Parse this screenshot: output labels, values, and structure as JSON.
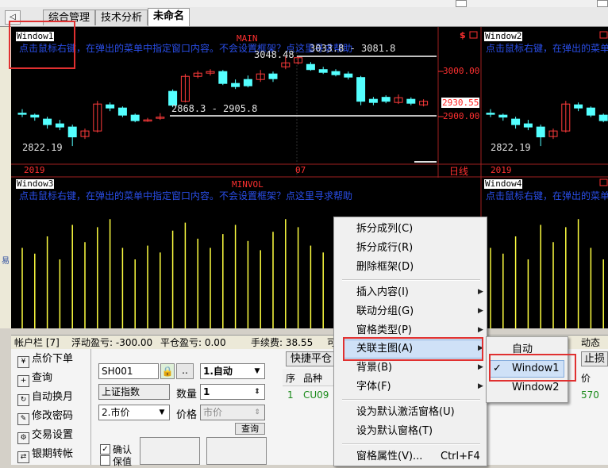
{
  "tabs": {
    "nav_glyph": "◁",
    "items": [
      {
        "label": "综合管理"
      },
      {
        "label": "技术分析"
      },
      {
        "label": "未命名"
      }
    ]
  },
  "gutter_text": "易",
  "chart": {
    "window1_label": "Window1",
    "window2_label": "Window2",
    "window3_label": "Window3",
    "window4_label": "Window4",
    "main_title": "MAIN",
    "minvol_title": "MINVOL",
    "hint_text": "点击鼠标右键，在弹出的菜单中指定窗口内容。不会设置框架？点这里寻求帮助",
    "currency_mark": "$",
    "high_label": "3048.48",
    "range_label_top": "3033.8 - 3081.8",
    "range_label_mid": "2868.3 - 2905.8",
    "low_label": "2822.19",
    "low_label_right": "2822.19",
    "price_3000": "3000.00",
    "price_current": "2930.55",
    "price_2900": "2900.00",
    "axis_year": "2019",
    "axis_year_right": "2019",
    "axis_month": "07",
    "axis_period": "日线"
  },
  "chart_data": {
    "type": "candlestick",
    "title": "MAIN",
    "period": "日线",
    "y_ticks": [
      3000.0,
      2900.0
    ],
    "current_price": 2930.55,
    "high": 3048.48,
    "low": 2822.19,
    "annotations": [
      "3033.8 - 3081.8",
      "2868.3 - 2905.8"
    ],
    "x_ticks": [
      "2019",
      "07"
    ],
    "candles": [
      {
        "o": 2905,
        "c": 2902,
        "h": 2915,
        "l": 2895
      },
      {
        "o": 2900,
        "c": 2895,
        "h": 2904,
        "l": 2886
      },
      {
        "o": 2890,
        "c": 2876,
        "h": 2896,
        "l": 2866
      },
      {
        "o": 2878,
        "c": 2870,
        "h": 2888,
        "l": 2862
      },
      {
        "o": 2870,
        "c": 2845,
        "h": 2876,
        "l": 2822
      },
      {
        "o": 2846,
        "c": 2860,
        "h": 2866,
        "l": 2840
      },
      {
        "o": 2860,
        "c": 2928,
        "h": 2936,
        "l": 2856
      },
      {
        "o": 2926,
        "c": 2918,
        "h": 2932,
        "l": 2910
      },
      {
        "o": 2918,
        "c": 2900,
        "h": 2922,
        "l": 2895
      },
      {
        "o": 2900,
        "c": 2886,
        "h": 2904,
        "l": 2882
      },
      {
        "o": 2886,
        "c": 2888,
        "h": 2893,
        "l": 2883
      },
      {
        "o": 2894,
        "c": 2895,
        "h": 2905,
        "l": 2888
      },
      {
        "o": 2960,
        "c": 2925,
        "h": 2965,
        "l": 2920
      },
      {
        "o": 2935,
        "c": 2998,
        "h": 3004,
        "l": 2932
      },
      {
        "o": 2998,
        "c": 3006,
        "h": 3012,
        "l": 2993
      },
      {
        "o": 3006,
        "c": 3010,
        "h": 3016,
        "l": 3000
      },
      {
        "o": 3010,
        "c": 2980,
        "h": 3014,
        "l": 2976
      },
      {
        "o": 2980,
        "c": 2972,
        "h": 2990,
        "l": 2966
      },
      {
        "o": 2990,
        "c": 2974,
        "h": 3000,
        "l": 2970
      },
      {
        "o": 2990,
        "c": 3004,
        "h": 3014,
        "l": 2984
      },
      {
        "o": 3004,
        "c": 2992,
        "h": 3010,
        "l": 2984
      },
      {
        "o": 3022,
        "c": 3032,
        "h": 3048,
        "l": 3016
      },
      {
        "o": 3032,
        "c": 3045,
        "h": 3048,
        "l": 3028
      },
      {
        "o": 3028,
        "c": 3015,
        "h": 3034,
        "l": 3012
      },
      {
        "o": 3015,
        "c": 3008,
        "h": 3022,
        "l": 3004
      },
      {
        "o": 3010,
        "c": 3002,
        "h": 3016,
        "l": 2998
      },
      {
        "o": 3004,
        "c": 2996,
        "h": 3010,
        "l": 2990
      },
      {
        "o": 2995,
        "c": 2935,
        "h": 2999,
        "l": 2925
      },
      {
        "o": 2940,
        "c": 2932,
        "h": 2946,
        "l": 2925
      },
      {
        "o": 2945,
        "c": 2935,
        "h": 2950,
        "l": 2930
      },
      {
        "o": 2932,
        "c": 2944,
        "h": 2952,
        "l": 2928
      },
      {
        "o": 2940,
        "c": 2930,
        "h": 2945,
        "l": 2925
      },
      {
        "o": 2926,
        "c": 2935,
        "h": 2940,
        "l": 2922
      }
    ],
    "volume": [
      70,
      65,
      80,
      60,
      90,
      75,
      88,
      95,
      70,
      60,
      72,
      66,
      85,
      92,
      78,
      70,
      82,
      90,
      76,
      68,
      84,
      95,
      88,
      72,
      66,
      80,
      74,
      92,
      70,
      64,
      86,
      78,
      70
    ]
  },
  "account": {
    "label": "帐户栏 [7]",
    "floating": "浮动盈亏: -300.00",
    "closed": "平仓盈亏: 0.00",
    "fee": "手续费: 38.55",
    "cut": "可",
    "right_cut": "动态权"
  },
  "sidebar": [
    {
      "label": "点价下单",
      "icon": "rmb-icon",
      "glyph": "¥"
    },
    {
      "label": "查询",
      "icon": "plus-icon",
      "glyph": "+"
    },
    {
      "label": "自动换月",
      "icon": "refresh-icon",
      "glyph": "↻"
    },
    {
      "label": "修改密码",
      "icon": "edit-icon",
      "glyph": "✎"
    },
    {
      "label": "交易设置",
      "icon": "gear-icon",
      "glyph": "⚙"
    },
    {
      "label": "银期转帐",
      "icon": "transfer-icon",
      "glyph": "⇄"
    }
  ],
  "order": {
    "code_value": "SH001",
    "more_glyph": "..",
    "mode_value": "1.自动",
    "name_value": "上证指数",
    "qty_label": "数量",
    "qty_value": "1",
    "price_type_value": "2.市价",
    "price_label": "价格",
    "price_value": "市价",
    "query_button": "查询",
    "confirm_label": "确认",
    "keep_label": "保值"
  },
  "positions": {
    "quick_close": "快捷平仓",
    "headers": [
      "序",
      "品种"
    ],
    "row": {
      "idx": "1",
      "symbol": "CU09",
      "tail": "570"
    },
    "stop_loss": "止损",
    "price_header_cut": "价"
  },
  "context_menu": {
    "items": [
      {
        "label": "拆分成列(C)",
        "submenu": false
      },
      {
        "label": "拆分成行(R)",
        "submenu": false
      },
      {
        "label": "删除框架(D)",
        "submenu": false
      },
      {
        "label": "插入内容(I)",
        "submenu": true
      },
      {
        "label": "联动分组(G)",
        "submenu": true
      },
      {
        "label": "窗格类型(P)",
        "submenu": true
      },
      {
        "label": "关联主图(A)",
        "submenu": true
      },
      {
        "label": "背景(B)",
        "submenu": true
      },
      {
        "label": "字体(F)",
        "submenu": true
      },
      {
        "label": "设为默认激活窗格(U)",
        "submenu": false
      },
      {
        "label": "设为默认窗格(T)",
        "submenu": false
      },
      {
        "label": "窗格属性(V)...",
        "submenu": false
      }
    ],
    "shortcut_last": "Ctrl+F4",
    "highlight_index": 6
  },
  "submenu": {
    "items": [
      {
        "label": "自动"
      },
      {
        "label": "Window1"
      },
      {
        "label": "Window2"
      }
    ],
    "checked_index": 1,
    "check_glyph": "✓"
  },
  "colors": {
    "chart_bg": "#000000",
    "bull": "#ff3b3b",
    "bear": "#54ffff",
    "volume": "#ffff40",
    "highlight_box": "#e03030",
    "menu_highlight": "#cfe1f7"
  }
}
